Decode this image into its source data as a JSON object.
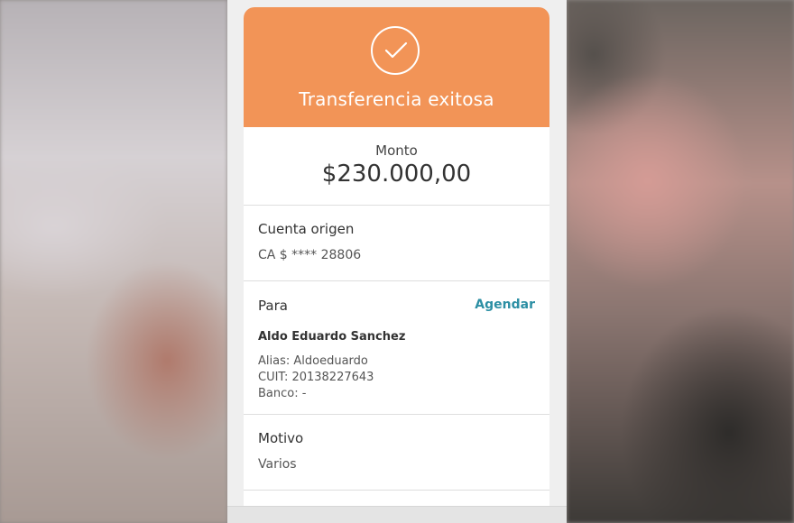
{
  "header": {
    "title": "Transferencia exitosa",
    "status_icon": "check-circle-icon",
    "color": "#f29457"
  },
  "amount": {
    "label": "Monto",
    "value": "$230.000,00"
  },
  "origin": {
    "label": "Cuenta origen",
    "value": "CA $ **** 28806"
  },
  "recipient": {
    "label": "Para",
    "schedule_link": "Agendar",
    "name": "Aldo Eduardo Sanchez",
    "alias": "Alias:  Aldoeduardo",
    "cuit": "CUIT:  20138227643",
    "bank": "Banco:  -"
  },
  "reason": {
    "label": "Motivo",
    "value": "Varios"
  },
  "colors": {
    "accent_link": "#2c8fa4"
  }
}
